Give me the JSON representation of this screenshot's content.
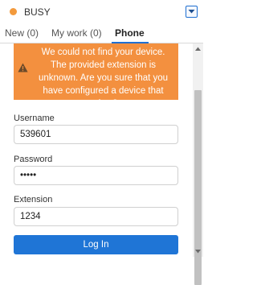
{
  "status": {
    "text": "BUSY",
    "dot_color": "#f39a3c"
  },
  "tabs": [
    {
      "label": "New (0)",
      "active": false
    },
    {
      "label": "My work (0)",
      "active": false
    },
    {
      "label": "Phone",
      "active": true
    }
  ],
  "warning": {
    "icon": "warning-triangle-icon",
    "message": "We could not find your device. The provided extension is unknown. Are you sure that you have configured a device that exists?",
    "color": "#f3903f"
  },
  "form": {
    "username": {
      "label": "Username",
      "value": "539601"
    },
    "password": {
      "label": "Password",
      "value": "•••••"
    },
    "extension": {
      "label": "Extension",
      "value": "1234"
    },
    "login_label": "Log In"
  },
  "accent_color": "#1f75d6"
}
